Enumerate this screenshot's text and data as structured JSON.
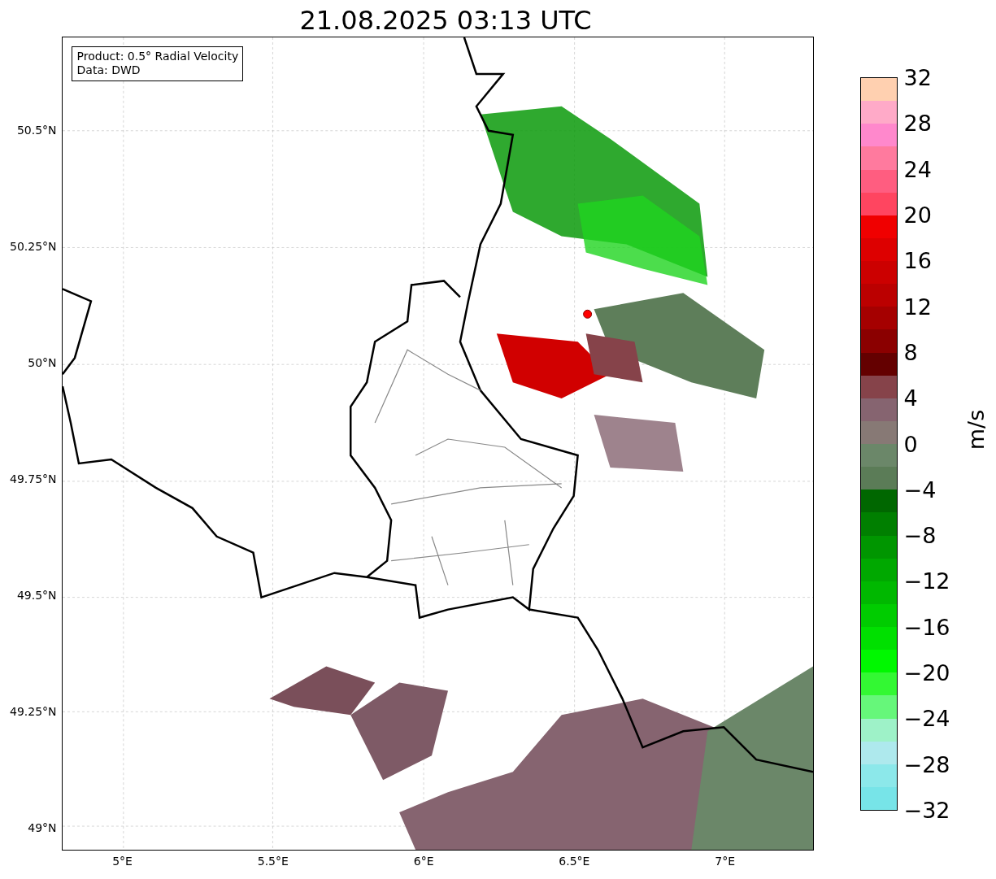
{
  "title": "21.08.2025 03:13 UTC",
  "map": {
    "info": [
      "Product: 0.5° Radial Velocity",
      "Data: DWD"
    ],
    "y_ticks": [
      "50.5°N",
      "50.25°N",
      "50°N",
      "49.75°N",
      "49.5°N",
      "49.25°N",
      "49°N"
    ],
    "x_ticks": [
      "5°E",
      "5.5°E",
      "6°E",
      "6.5°E",
      "7°E"
    ]
  },
  "colorbar": {
    "label": "m/s",
    "ticks": [
      "32",
      "28",
      "24",
      "20",
      "16",
      "12",
      "8",
      "4",
      "0",
      "−4",
      "−8",
      "−12",
      "−16",
      "−20",
      "−24",
      "−28",
      "−32"
    ],
    "bands": [
      {
        "color": "#ffd0b0"
      },
      {
        "color": "#ffaac8"
      },
      {
        "color": "#ff88cc"
      },
      {
        "color": "#ff7a9e"
      },
      {
        "color": "#ff5d80"
      },
      {
        "color": "#ff4560"
      },
      {
        "color": "#f00000"
      },
      {
        "color": "#dd0000"
      },
      {
        "color": "#cc0000"
      },
      {
        "color": "#bb0000"
      },
      {
        "color": "#a50000"
      },
      {
        "color": "#8b0000"
      },
      {
        "color": "#640000"
      },
      {
        "color": "#86434a"
      },
      {
        "color": "#866470"
      },
      {
        "color": "#877975"
      },
      {
        "color": "#6b8769"
      },
      {
        "color": "#5b7c57"
      },
      {
        "color": "#006700"
      },
      {
        "color": "#007f00"
      },
      {
        "color": "#009600"
      },
      {
        "color": "#00a800"
      },
      {
        "color": "#00b800"
      },
      {
        "color": "#00cc00"
      },
      {
        "color": "#00e000"
      },
      {
        "color": "#00f800"
      },
      {
        "color": "#33f833"
      },
      {
        "color": "#66f77a"
      },
      {
        "color": "#9ef2c8"
      },
      {
        "color": "#aee9ed"
      },
      {
        "color": "#8ce8ea"
      },
      {
        "color": "#77e4e8"
      }
    ]
  }
}
